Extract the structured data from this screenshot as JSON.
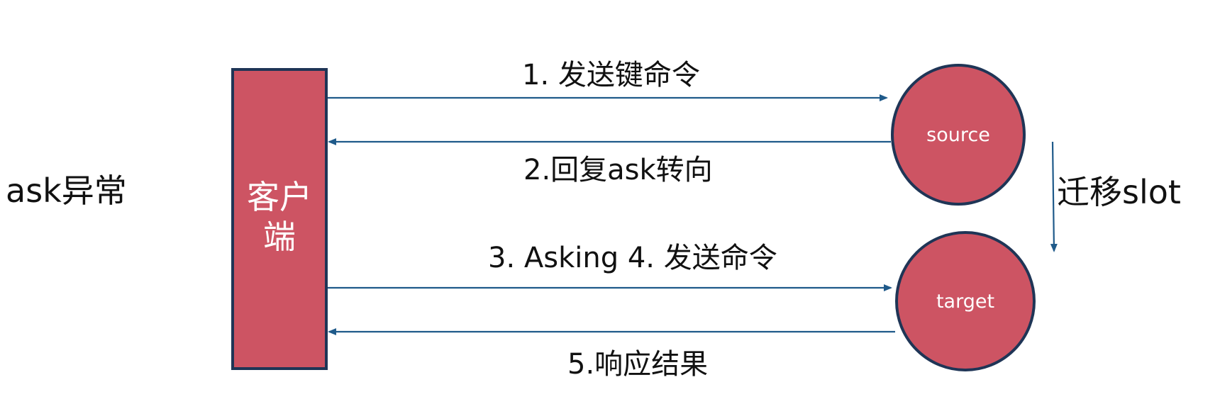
{
  "title": "ask异常",
  "client": {
    "label": "客户端"
  },
  "nodes": {
    "source": "source",
    "target": "target"
  },
  "messages": {
    "step1": "1. 发送键命令",
    "step2": "2.回复ask转向",
    "step3_4": "3. Asking 4. 发送命令",
    "step5": "5.响应结果"
  },
  "migration": {
    "label": "迁移slot"
  },
  "colors": {
    "node_fill": "#cd5463",
    "node_border": "#1f3556",
    "arrow": "#1f5a8a"
  }
}
